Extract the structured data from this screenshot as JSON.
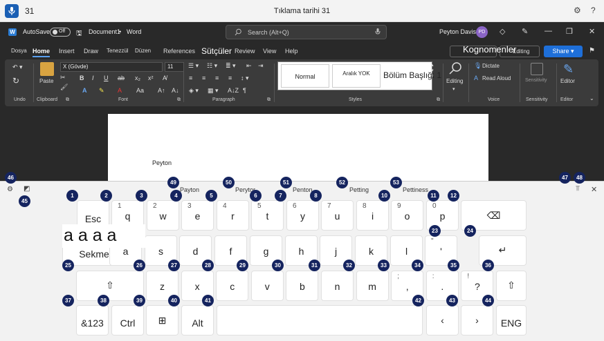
{
  "voice_bar": {
    "count": "31",
    "status": "Tıklama tarihi 31",
    "settings_icon": "gear-icon",
    "help": "?"
  },
  "word": {
    "autosave": "AutoSave",
    "toggle": "Off",
    "doc_title": "Document1",
    "app": "Word",
    "search_placeholder": "Search (Alt+Q)",
    "user": "Peyton Davis",
    "initials": "PD",
    "menu": [
      "Dosya",
      "Home",
      "Insert",
      "Draw",
      "Tenezzül",
      "Düzen",
      "References",
      "Sütçüler",
      "Review",
      "View",
      "Help"
    ],
    "comments_overlay": "Kognomenler",
    "editing_pill": "Editing",
    "share": "Share",
    "font_name": "X (Gövde)",
    "font_size": "11",
    "styles": [
      "Normal",
      "Aralık YOK",
      "Bölüm Başlığı 1"
    ],
    "groups": [
      "Undo",
      "Clipboard",
      "Font",
      "Paragraph",
      "Styles",
      "Voice",
      "Sensitivity",
      "Editor"
    ],
    "paste": "Paste",
    "editing": "Editing",
    "dictate": "Dictate",
    "read_aloud": "Read Aloud",
    "sensitivity": "Sensitivity",
    "editor": "Editor",
    "document_text": "Peyton"
  },
  "keyboard": {
    "suggestions": [
      "Payton",
      "Perytor",
      "Penton",
      "Petting",
      "Pettiness"
    ],
    "typed_text": "a a a a",
    "row1": [
      {
        "main": "Esc",
        "sub": ""
      },
      {
        "main": "q",
        "sub": "1"
      },
      {
        "main": "w",
        "sub": "2"
      },
      {
        "main": "e",
        "sub": "3"
      },
      {
        "main": "r",
        "sub": "4"
      },
      {
        "main": "t",
        "sub": "5"
      },
      {
        "main": "y",
        "sub": "6"
      },
      {
        "main": "u",
        "sub": "7"
      },
      {
        "main": "i",
        "sub": "8"
      },
      {
        "main": "o",
        "sub": "9"
      },
      {
        "main": "p",
        "sub": "0"
      }
    ],
    "row2": [
      {
        "main": "Sekme",
        "sub": ""
      },
      {
        "main": "a",
        "sub": ""
      },
      {
        "main": "s",
        "sub": ""
      },
      {
        "main": "d",
        "sub": ""
      },
      {
        "main": "f",
        "sub": ""
      },
      {
        "main": "g",
        "sub": ""
      },
      {
        "main": "h",
        "sub": ""
      },
      {
        "main": "j",
        "sub": ""
      },
      {
        "main": "k",
        "sub": ""
      },
      {
        "main": "l",
        "sub": ""
      },
      {
        "main": "'",
        "sub": "\""
      }
    ],
    "row3": [
      {
        "main": "z",
        "sub": ""
      },
      {
        "main": "x",
        "sub": ""
      },
      {
        "main": "c",
        "sub": ""
      },
      {
        "main": "v",
        "sub": ""
      },
      {
        "main": "b",
        "sub": ""
      },
      {
        "main": "n",
        "sub": ""
      },
      {
        "main": "m",
        "sub": ""
      },
      {
        "main": ",",
        "sub": ";"
      },
      {
        "main": ".",
        "sub": ":"
      },
      {
        "main": "?",
        "sub": "!"
      }
    ],
    "row4": [
      "&123",
      "Ctrl",
      "Alt",
      "ENG"
    ],
    "badges": [
      "1",
      "2",
      "3",
      "4",
      "5",
      "6",
      "7",
      "8",
      "10",
      "11",
      "12",
      "23",
      "24",
      "25",
      "26",
      "27",
      "28",
      "29",
      "30",
      "31",
      "32",
      "33",
      "34",
      "35",
      "36",
      "37",
      "38",
      "39",
      "40",
      "41",
      "42",
      "43",
      "44",
      "45",
      "46",
      "47",
      "48",
      "49",
      "50",
      "51",
      "52",
      "53"
    ]
  }
}
